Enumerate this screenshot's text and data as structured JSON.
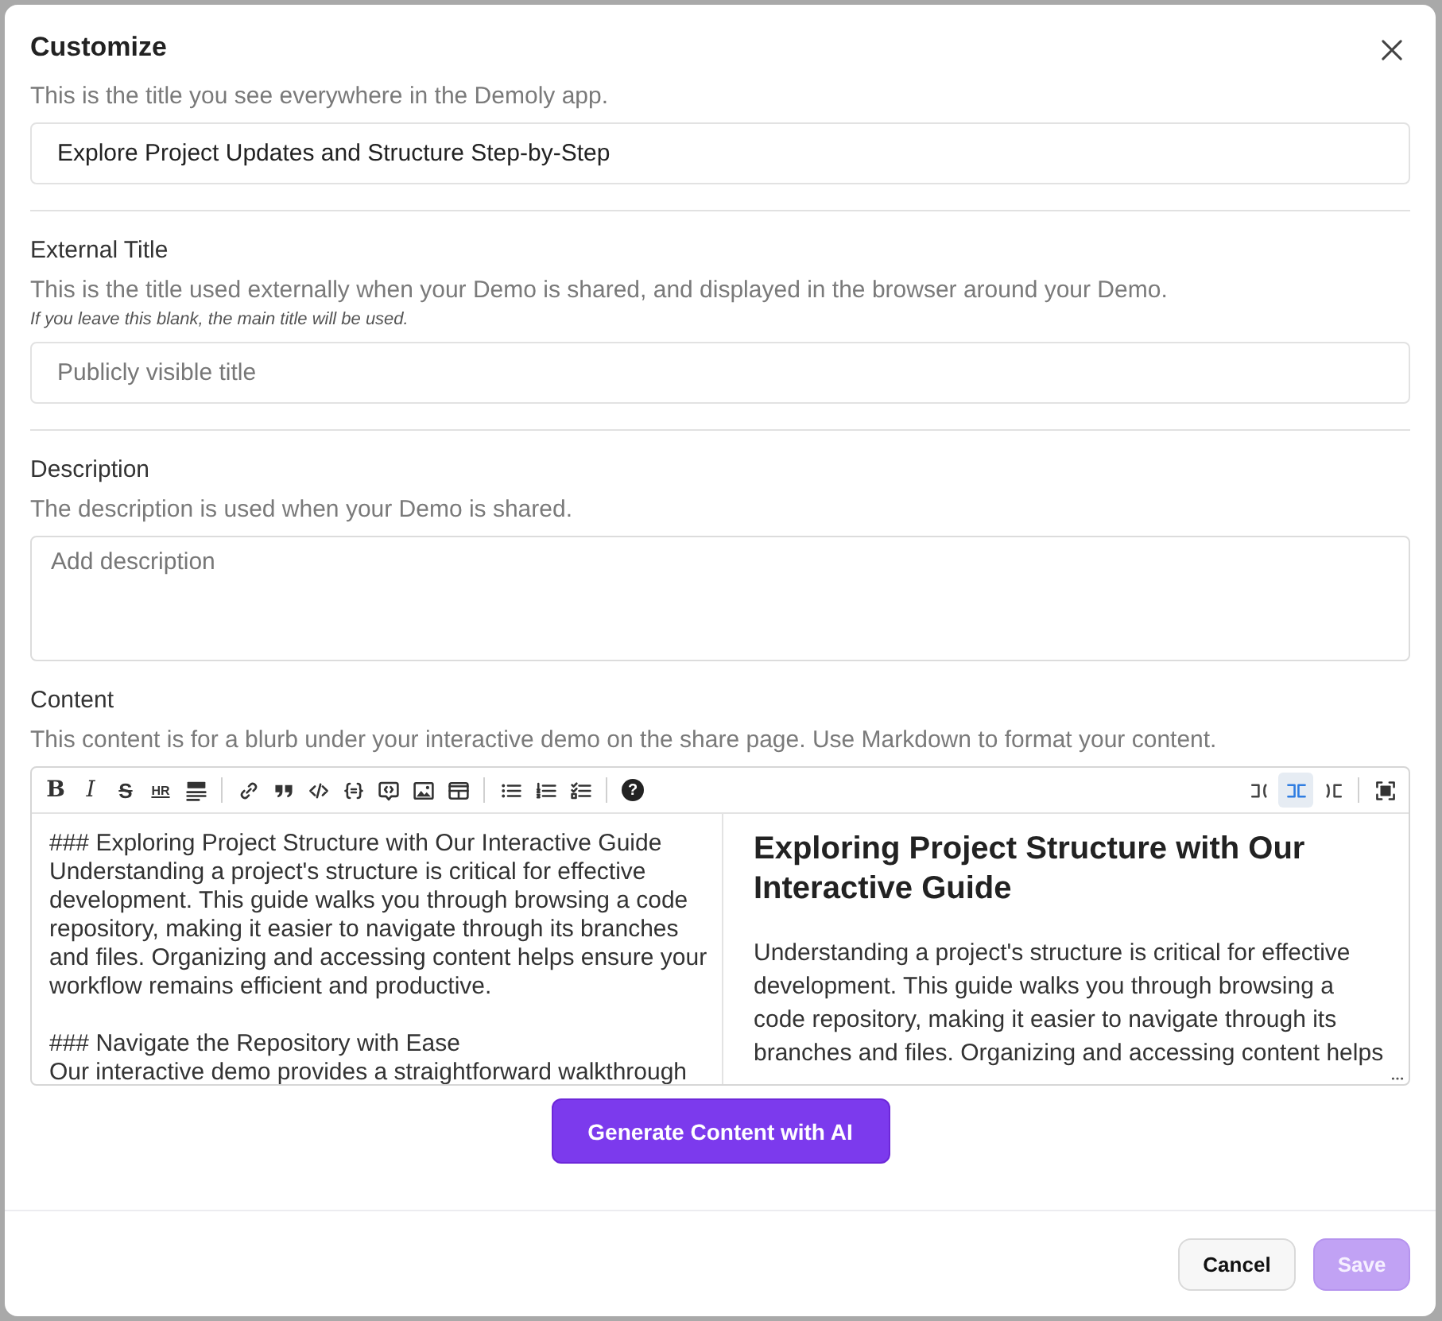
{
  "dialog": {
    "title": "Customize"
  },
  "groups": [
    [
      {
        "kind": "input",
        "hint": "This is the title you see everywhere in the Demoly app.",
        "value": "Explore Project Updates and Structure Step-by-Step"
      }
    ],
    [
      {
        "kind": "input",
        "label": "External Title",
        "hint": "This is the title used externally when your Demo is shared, and displayed in the browser around your Demo.",
        "note": "If you leave this blank, the main title will be used.",
        "placeholder": "Publicly visible title"
      }
    ],
    [
      {
        "kind": "textarea",
        "label": "Description",
        "hint": "The description is used when your Demo is shared.",
        "placeholder": "Add description"
      },
      {
        "kind": "editor",
        "label": "Content",
        "hint": "This content is for a blurb under your interactive demo on the share page. Use Markdown to format your content."
      }
    ]
  ],
  "editor": {
    "toolbar": [
      [
        {
          "kind": "bold",
          "label": "B"
        },
        {
          "kind": "italic",
          "label": "I"
        },
        {
          "kind": "strike",
          "label": "S"
        },
        {
          "kind": "hr",
          "label": "HR"
        },
        {
          "kind": "heading"
        }
      ],
      [
        {
          "kind": "link"
        },
        {
          "kind": "quote"
        },
        {
          "kind": "code"
        },
        {
          "kind": "codeblock"
        },
        {
          "kind": "preview"
        },
        {
          "kind": "image"
        },
        {
          "kind": "table"
        }
      ],
      [
        {
          "kind": "ul"
        },
        {
          "kind": "ol"
        },
        {
          "kind": "tasks"
        }
      ],
      [
        {
          "kind": "help",
          "label": "?"
        }
      ]
    ],
    "view_modes": [
      {
        "kind": "editor",
        "selected": false
      },
      {
        "kind": "split",
        "selected": true
      },
      {
        "kind": "preview-only",
        "selected": false
      }
    ],
    "tools_right": [
      {
        "kind": "fullscreen"
      }
    ],
    "source": "### Exploring Project Structure with Our Interactive Guide\nUnderstanding a project's structure is critical for effective development. This guide walks you through browsing a code repository, making it easier to navigate through its branches and files. Organizing and accessing content helps ensure your workflow remains efficient and productive.\n\n### Navigate the Repository with Ease\nOur interactive demo provides a straightforward walkthrough",
    "preview": {
      "heading": "Exploring Project Structure with Our Interactive Guide",
      "paragraph": "Understanding a project's structure is critical for effective development. This guide walks you through browsing a code repository, making it easier to navigate through its branches and files. Organizing and accessing content helps"
    }
  },
  "generate_button": "Generate Content with AI",
  "footer_buttons": [
    {
      "kind": "secondary",
      "label": "Cancel",
      "disabled": false
    },
    {
      "kind": "primary",
      "label": "Save",
      "disabled": true
    }
  ]
}
